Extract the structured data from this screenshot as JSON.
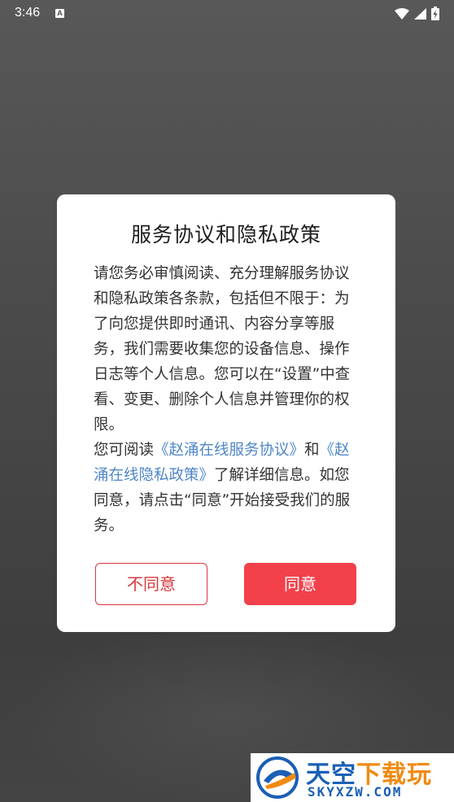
{
  "status_bar": {
    "time": "3:46",
    "notification_badge": "A",
    "icons": [
      "wifi-icon",
      "signal-icon",
      "battery-icon"
    ]
  },
  "dialog": {
    "title": "服务协议和隐私政策",
    "para1": "请您务必审慎阅读、充分理解服务协议和隐私政策各条款，包括但不限于：为了向您提供即时通讯、内容分享等服务，我们需要收集您的设备信息、操作日志等个人信息。您可以在“设置”中查看、变更、删除个人信息并管理你的权限。",
    "para2_prefix": "您可阅读",
    "service_link": "《赵涌在线服务协议》",
    "para2_and": "和",
    "privacy_link": "《赵涌在线隐私政策》",
    "para2_suffix": "了解详细信息。如您同意，请点击“同意”开始接受我们的服务。",
    "disagree_label": "不同意",
    "agree_label": "同意"
  },
  "watermark": {
    "text_cn_main": "天空",
    "text_cn_accent": "下载玩",
    "text_en": "SKYXZW.COM"
  },
  "colors": {
    "accent_red": "#f2414b",
    "link_blue": "#4f86c8",
    "overlay": "#4a4a4a"
  }
}
